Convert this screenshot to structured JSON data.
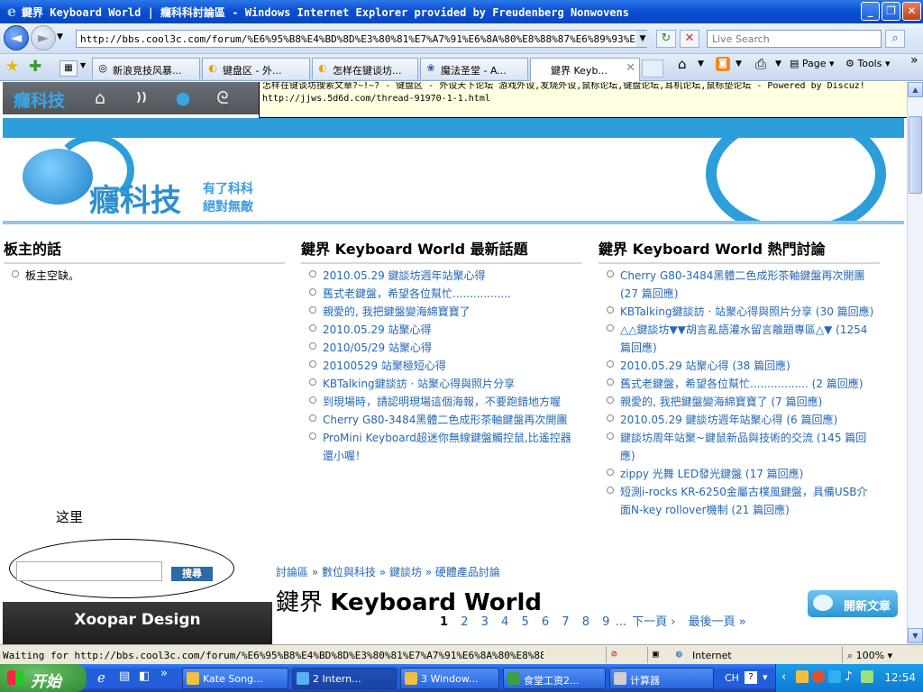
{
  "window": {
    "title": "鍵界 Keyboard World | 癮科科討論區 - Windows Internet Explorer provided by Freudenberg Nonwovens",
    "minimize_icon": "_",
    "maximize_icon": "❐",
    "close_icon": "✕"
  },
  "address_bar": {
    "url": "http://bbs.cool3c.com/forum/%E6%95%B8%E4%BD%8D%E3%80%81%E7%A7%91%E6%8A%80%E8%88%87%E6%89%93%E5%B1%81",
    "search_placeholder": "Live Search",
    "back_icon": "◄",
    "forward_icon": "►",
    "refresh_icon": "↻",
    "stop_icon": "✕",
    "search_icon": "⌕"
  },
  "tabs": [
    {
      "label": "新浪竞技风暴...",
      "icon": "◎",
      "active": false
    },
    {
      "label": "键盘区 - 外...",
      "icon": "◐",
      "active": false
    },
    {
      "label": "怎样在键谈坊...",
      "icon": "◐",
      "active": false
    },
    {
      "label": "魔法圣堂 - A...",
      "icon": "❀",
      "active": false
    },
    {
      "label": "鍵界 Keyb...",
      "icon": "",
      "active": true
    }
  ],
  "commands": {
    "page": "Page",
    "tools": "Tools",
    "home_icon": "⌂",
    "feeds_icon": "◙",
    "print_icon": "⎙",
    "more": "»"
  },
  "tooltip": {
    "line1": "怎样在键谈坊搜索文章?~!~? - 键盘区 - 外设天下论坛 游戏外设,发烧外设,鼠标论坛,键盘论坛,耳机论坛,鼠标垫论坛 - Powered by Discuz!",
    "line2": "http://jjws.5d6d.com/thread-91970-1-1.html"
  },
  "site": {
    "nav_logo": "癮科技",
    "banner_brand": "癮科技",
    "slogan1": "有了科科",
    "slogan2": "絕對無敵",
    "nav_icons": {
      "home": "⌂",
      "rss": "))",
      "chat": "●",
      "ribbon": "ᘓ"
    }
  },
  "columns": {
    "moderator": {
      "heading": "板主的話",
      "items": [
        "板主空缺。"
      ]
    },
    "latest": {
      "heading": "鍵界 Keyboard World 最新話題",
      "items": [
        "2010.05.29 鍵談坊週年站聚心得",
        "舊式老鍵盤，希望各位幫忙.................",
        "親愛的, 我把鍵盤變海綿寶寶了",
        "2010.05.29 站聚心得",
        "2010/05/29 站聚心得",
        "20100529 站聚極短心得",
        "KBTalking鍵談訪 · 站聚心得與照片分享",
        "到現場時，請認明現場這個海報，不要跑錯地方喔",
        "Cherry G80-3484黑體二色成形茶軸鍵盤再次開團",
        "ProMini Keyboard超迷你無線鍵盤觸控鼠,比遙控器還小喔！"
      ]
    },
    "hot": {
      "heading": "鍵界 Keyboard World 熱門討論",
      "items": [
        "Cherry G80-3484黑體二色成形茶軸鍵盤再次開團 (27 篇回應)",
        "KBTalking鍵談訪 · 站聚心得與照片分享 (30 篇回應)",
        "△△鍵談坊▼▼胡言亂語灌水留言離題專區△▼ (1254 篇回應)",
        "2010.05.29 站聚心得 (38 篇回應)",
        "舊式老鍵盤，希望各位幫忙................. (2 篇回應)",
        "親愛的, 我把鍵盤變海綿寶寶了 (7 篇回應)",
        "2010.05.29 鍵談坊週年站聚心得 (6 篇回應)",
        "鍵談坊周年站聚~鍵鼠新品與技術的交流 (145 篇回應)",
        "zippy 光舞 LED發光鍵盤 (17 篇回應)",
        "短測i-rocks KR-6250金屬古樸風鍵盤，具備USB介面N-key rollover機制 (21 篇回應)"
      ]
    }
  },
  "annotation_text": "这里",
  "search_button": "搜尋",
  "ad_text": "Xoopar Design",
  "breadcrumb": "討論區 » 數位與科技 » 鍵談坊 » 硬體產品討論",
  "forum_title_prefix": "鍵界 ",
  "forum_title_main": "Keyboard World",
  "new_post_button": "開新文章",
  "pager": {
    "pages": [
      "1",
      "2",
      "3",
      "4",
      "5",
      "6",
      "7",
      "8",
      "9"
    ],
    "current": "1",
    "ellipsis": "...",
    "next": "下一頁 ›",
    "last": "最後一頁 »"
  },
  "status_bar": {
    "text": "Waiting for http://bbs.cool3c.com/forum/%E6%95%B8%E4%BD%8D%E3%80%81%E7%A7%91%E6%8A%80%E8%88%87%E6%89",
    "zone": "Internet",
    "zoom": "100%"
  },
  "taskbar": {
    "start": "开始",
    "tasks": [
      {
        "label": "Kate Song..."
      },
      {
        "label": "2 Intern..."
      },
      {
        "label": "3 Window..."
      },
      {
        "label": "食堂工资2..."
      },
      {
        "label": "计算器"
      }
    ],
    "ime": "CH",
    "clock": "12:54"
  }
}
